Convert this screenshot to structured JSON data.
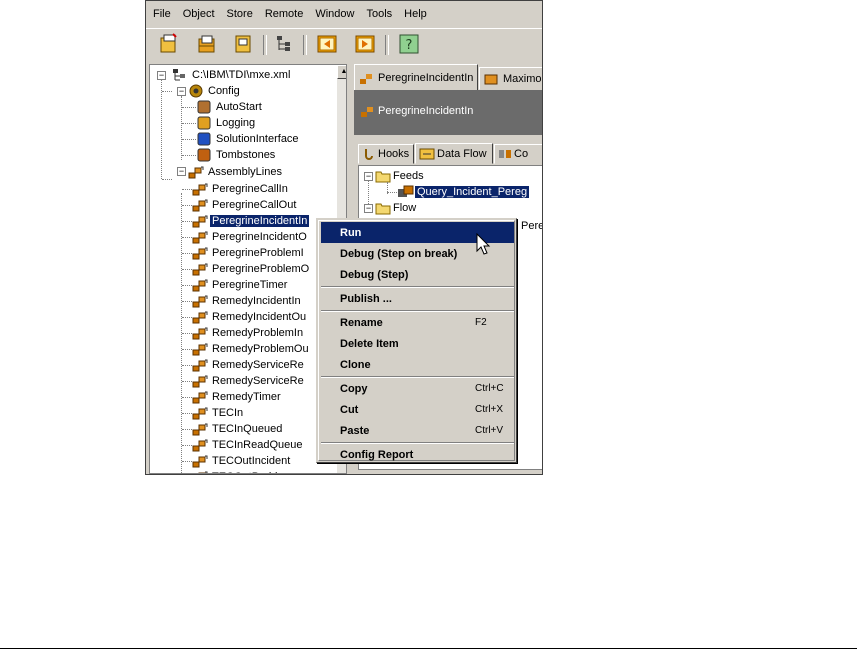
{
  "menubar": [
    "File",
    "Object",
    "Store",
    "Remote",
    "Window",
    "Tools",
    "Help"
  ],
  "tree": {
    "root": "C:\\IBM\\TDI\\mxe.xml",
    "config_label": "Config",
    "config_items": [
      "AutoStart",
      "Logging",
      "SolutionInterface",
      "Tombstones"
    ],
    "assemblylines_label": "AssemblyLines",
    "assemblylines": [
      "PeregrineCallIn",
      "PeregrineCallOut",
      "PeregrineIncidentIn",
      "PeregrineIncidentO",
      "PeregrineProblemI",
      "PeregrineProblemO",
      "PeregrineTimer",
      "RemedyIncidentIn",
      "RemedyIncidentOu",
      "RemedyProblemIn",
      "RemedyProblemOu",
      "RemedyServiceRe",
      "RemedyServiceRe",
      "RemedyTimer",
      "TECIn",
      "TECInQueued",
      "TECInReadQueue",
      "TECOutIncident",
      "TECOutProblem"
    ],
    "selected_index": 2
  },
  "right_panel": {
    "tabs": [
      "PeregrineIncidentIn",
      "Maximo"
    ],
    "header_title": "PeregrineIncidentIn",
    "subtabs": [
      "Hooks",
      "Data Flow",
      "Co"
    ],
    "feeds_label": "Feeds",
    "feeds_item": "Query_Incident_Pereg",
    "flow_label": "Flow",
    "flow_item_partial": "Pere"
  },
  "context_menu": {
    "groups": [
      [
        {
          "label": "Run",
          "shortcut": ""
        },
        {
          "label": "Debug (Step on break)",
          "shortcut": ""
        },
        {
          "label": "Debug (Step)",
          "shortcut": ""
        }
      ],
      [
        {
          "label": "Publish ...",
          "shortcut": ""
        }
      ],
      [
        {
          "label": "Rename",
          "shortcut": "F2"
        },
        {
          "label": "Delete Item",
          "shortcut": ""
        },
        {
          "label": "Clone",
          "shortcut": ""
        }
      ],
      [
        {
          "label": "Copy",
          "shortcut": "Ctrl+C"
        },
        {
          "label": "Cut",
          "shortcut": "Ctrl+X"
        },
        {
          "label": "Paste",
          "shortcut": "Ctrl+V"
        }
      ],
      [
        {
          "label": "Config Report",
          "shortcut": ""
        }
      ]
    ],
    "highlighted": "Run"
  },
  "colors": {
    "selection": "#0a246a",
    "chrome": "#d4d0c8",
    "header": "#6b6b6b"
  },
  "icons": [
    "new-icon",
    "open-icon",
    "save-icon",
    "tree-icon",
    "back-icon",
    "forward-icon",
    "help-icon",
    "assemblyline-icon",
    "folder-icon",
    "cursor-icon"
  ]
}
